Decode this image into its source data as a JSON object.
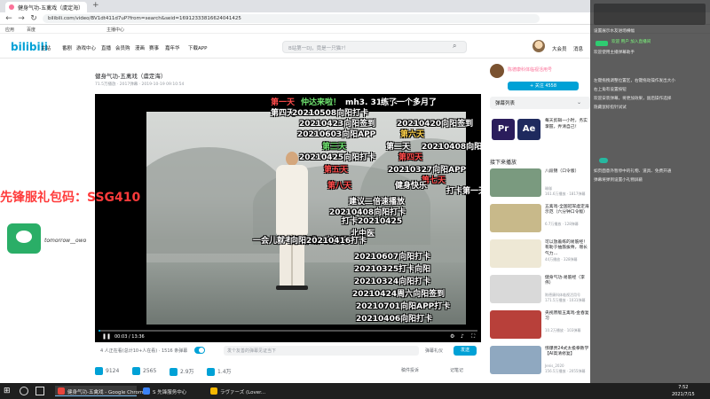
{
  "browser": {
    "tab_title": "健身气功-五禽戏（虞定海）",
    "url": "bilibili.com/video/BV1dt411d7uP?from=search&seid=16912333816624041425",
    "bookmarks": [
      "应用",
      "百度",
      "主播中心"
    ]
  },
  "header": {
    "logo": "bilibili",
    "nav": [
      "主站",
      "番剧",
      "游戏中心",
      "直播",
      "会员购",
      "漫画",
      "赛事",
      "嘉年华",
      "下载APP"
    ],
    "search_placeholder": "B站第一DJ，竟是一只猫?！",
    "right": [
      "大会员",
      "消息",
      "动态",
      "收藏",
      "历史",
      "创作中心",
      "投稿"
    ]
  },
  "video": {
    "title": "健身气功-五禽戏（虞定海）",
    "meta": "71.5万播放 · 2017弹幕 · 2019-10-19 09:10:54",
    "time": "00:03 / 13:36",
    "progress": 0.005,
    "viewers": "4 人正在看(总计10+人在看) · 1516 条弹幕",
    "danmaku_placeholder": "发个友善的弹幕见证当下",
    "danmaku_etiquette": "弹幕礼仪",
    "send": "发送",
    "likes": "9124",
    "coins": "2565",
    "favorites": "2.9万",
    "shares": "1.4万",
    "report": "稿件投诉",
    "notes": "记笔记"
  },
  "danmaku": [
    {
      "text": "第一天",
      "color": "red"
    },
    {
      "text": "仲达来啦！",
      "color": "green"
    },
    {
      "text": "mh3. 31打卡",
      "color": "white"
    },
    {
      "text": "练了一个多月了",
      "color": "white"
    },
    {
      "text": "第四天",
      "color": "white"
    },
    {
      "text": "20210508向阳打卡",
      "color": "white"
    },
    {
      "text": "20210423向阳签到",
      "color": "white"
    },
    {
      "text": "20210420向阳签到",
      "color": "white"
    },
    {
      "text": "20210603向阳APP",
      "color": "white"
    },
    {
      "text": "第六天",
      "color": "yellow"
    },
    {
      "text": "第三天",
      "color": "green"
    },
    {
      "text": "第二天",
      "color": "white"
    },
    {
      "text": "20210408向阳打卡",
      "color": "white"
    },
    {
      "text": "20210425向阳打卡",
      "color": "white"
    },
    {
      "text": "第四天",
      "color": "red"
    },
    {
      "text": "第五天",
      "color": "red"
    },
    {
      "text": "20210327向阳APP",
      "color": "white"
    },
    {
      "text": "第七天",
      "color": "red"
    },
    {
      "text": "第八天",
      "color": "red"
    },
    {
      "text": "健身快乐",
      "color": "white"
    },
    {
      "text": "打卡第一天",
      "color": "white"
    },
    {
      "text": "建议二倍速播放",
      "color": "white"
    },
    {
      "text": "20210408向阳打卡",
      "color": "white"
    },
    {
      "text": "打卡20210425",
      "color": "white"
    },
    {
      "text": "北中医",
      "color": "white"
    },
    {
      "text": "一会儿就考五禽戏，先复习一下",
      "color": "white"
    },
    {
      "text": "向阳20210416打卡",
      "color": "white"
    },
    {
      "text": "20210607向阳打卡",
      "color": "white"
    },
    {
      "text": "20210325打卡向阳",
      "color": "white"
    },
    {
      "text": "20210324向阳打卡",
      "color": "white"
    },
    {
      "text": "20210424周六向阳签到",
      "color": "white"
    },
    {
      "text": "20210701向阳APP打卡",
      "color": "white"
    },
    {
      "text": "20210406向阳打卡",
      "color": "white"
    }
  ],
  "overlay": {
    "promo": "先锋服礼包码：SSG410",
    "wechat_id": "tomorrow__owo"
  },
  "uploader": {
    "name": "陈德康科体临视活用号",
    "follow": "+ 关注 4558"
  },
  "sidebar": {
    "danmaku_list": "弹幕列表",
    "ad_text": "每天剪辑一小时，务实掌握，弄清自己！",
    "next_header": "接下来播放",
    "autoplay": "自动连播",
    "recs": [
      {
        "title": "八段锦（口令版）",
        "sub": "瑜珈",
        "meta": "161.6万播放 · 1817弹幕",
        "color": "#7a9a7f"
      },
      {
        "title": "五禽戏-全国冠军虞定海示范（六分钟口令版）",
        "sub": "",
        "meta": "6.7万播放 · 128弹幕",
        "color": "#c8b98a"
      },
      {
        "title": "可以放着练的易筋经！有助于抽筋拔骨，增长气力…",
        "sub": "",
        "meta": "44万播放 · 328弹幕",
        "color": "#eee8d5"
      },
      {
        "title": "健身气功-易筋经（李伟）",
        "sub": "陈德康科体临视活用号",
        "meta": "171.5万播放 · 1031弹幕",
        "color": "#d9d9d9"
      },
      {
        "title": "央视原版五禽戏-金春复习",
        "sub": "",
        "meta": "10.2万播放 · 103弹幕",
        "color": "#b8403a"
      },
      {
        "title": "惊爆贵24式太极拳教学【AI高清修复】",
        "sub": "Jenis_2020",
        "meta": "156.5万播放 · 2055弹幕",
        "color": "#8fa8c0"
      }
    ]
  },
  "notifications": {
    "lines": [
      "设置展示水友进场横幅",
      "欢迎 用户 加入直播间",
      "欢迎使用主播弹幕助手",
      "左键拖拽调整位置区，右键拖动操作发出大小",
      "右上角有设置按钮",
      "欢迎安装弹幕，将更加效果，副后操作选择",
      "隐藏鼠标指针试试",
      "如页面意外暂停中的礼物、道具、免费开通",
      "弹幕将弹到设置小礼物屏蔽"
    ]
  },
  "taskbar": {
    "items": [
      "健身气功-五禽戏 - Google Chrome",
      "S 先锋服务中心",
      "ラヴァーズ (Lover..."
    ],
    "time": "7:52",
    "date": "2021/7/15"
  }
}
